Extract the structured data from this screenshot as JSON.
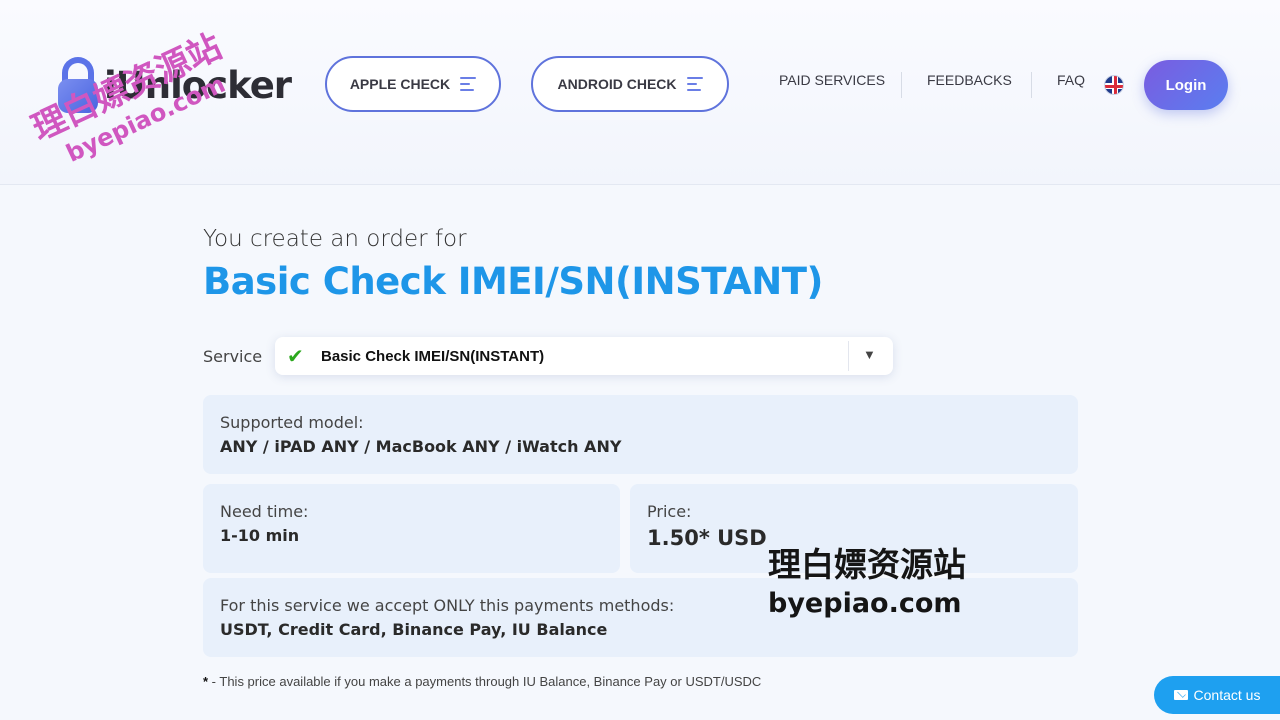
{
  "header": {
    "logo_text": "iUnlocker",
    "apple_check": "APPLE CHECK",
    "android_check": "ANDROID CHECK",
    "nav": [
      "PAID SERVICES",
      "FEEDBACKS",
      "FAQ"
    ],
    "login": "Login",
    "language_icon": "uk-flag-icon"
  },
  "order": {
    "intro": "You create an order for",
    "title": "Basic Check IMEI/SN(INSTANT)",
    "service_label": "Service",
    "service_selected": "Basic Check IMEI/SN(INSTANT)"
  },
  "cards": {
    "supported_label": "Supported model:",
    "supported_value": "ANY / iPAD ANY / MacBook ANY / iWatch ANY",
    "time_label": "Need time:",
    "time_value": "1-10 min",
    "price_label": "Price:",
    "price_value": "1.50* USD",
    "payments_label": "For this service we accept ONLY this payments methods:",
    "payments_value": "USDT, Credit Card, Binance Pay, IU Balance"
  },
  "footnote": {
    "star": "*",
    "text": " - This price available if you make a payments through IU Balance, Binance Pay or USDT/USDC"
  },
  "contact": {
    "label": "Contact us"
  },
  "watermark": {
    "cn": "理白嫖资源站",
    "url": "byepiao.com"
  },
  "colors": {
    "accent": "#1e96e8",
    "pill_border": "#5f73dc",
    "check": "#2ca81e",
    "card_bg": "#e8f0fb"
  }
}
